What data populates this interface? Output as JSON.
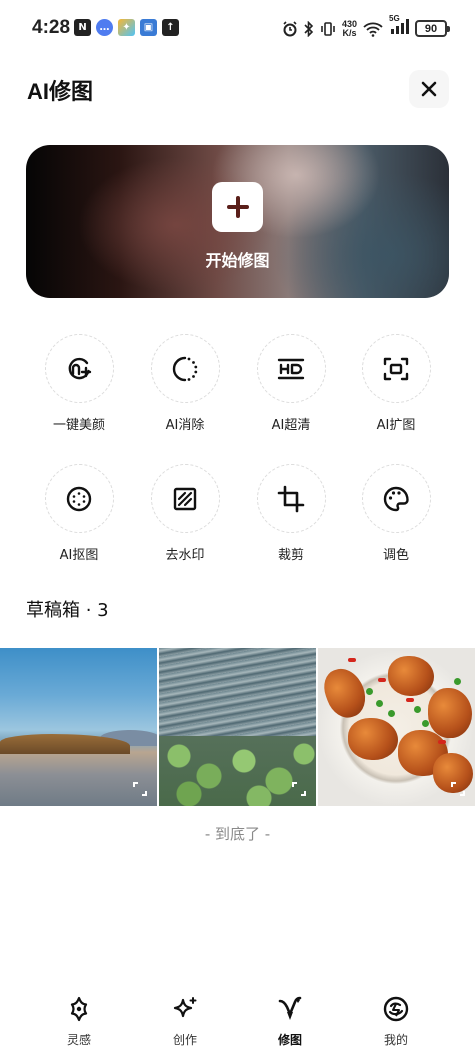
{
  "status_bar": {
    "time": "4:28",
    "net_speed_value": "430",
    "net_speed_unit": "K/s",
    "network_type": "5G",
    "battery": "90"
  },
  "header": {
    "title": "AI修图",
    "close_icon": "close-icon"
  },
  "hero": {
    "label": "开始修图",
    "icon": "plus-icon"
  },
  "tools": [
    {
      "label": "一键美颜",
      "icon": "beauty-icon"
    },
    {
      "label": "AI消除",
      "icon": "erase-icon"
    },
    {
      "label": "AI超清",
      "icon": "hd-icon"
    },
    {
      "label": "AI扩图",
      "icon": "expand-image-icon"
    },
    {
      "label": "AI抠图",
      "icon": "cutout-icon"
    },
    {
      "label": "去水印",
      "icon": "watermark-icon"
    },
    {
      "label": "裁剪",
      "icon": "crop-icon"
    },
    {
      "label": "调色",
      "icon": "palette-icon"
    }
  ],
  "drafts": {
    "title": "草稿箱 · 3",
    "items": [
      {
        "subject": "lake"
      },
      {
        "subject": "lily-pond"
      },
      {
        "subject": "roast-chicken"
      }
    ]
  },
  "end_text": "- 到底了 -",
  "tabbar": [
    {
      "label": "灵感",
      "icon": "inspiration-icon",
      "active": false
    },
    {
      "label": "创作",
      "icon": "sparkle-icon",
      "active": false
    },
    {
      "label": "修图",
      "icon": "edit-photo-icon",
      "active": true
    },
    {
      "label": "我的",
      "icon": "profile-icon",
      "active": false
    }
  ],
  "colors": {
    "text_primary": "#111111",
    "text_muted": "#8a8a8a",
    "accent_dark": "#5a1f1a"
  }
}
